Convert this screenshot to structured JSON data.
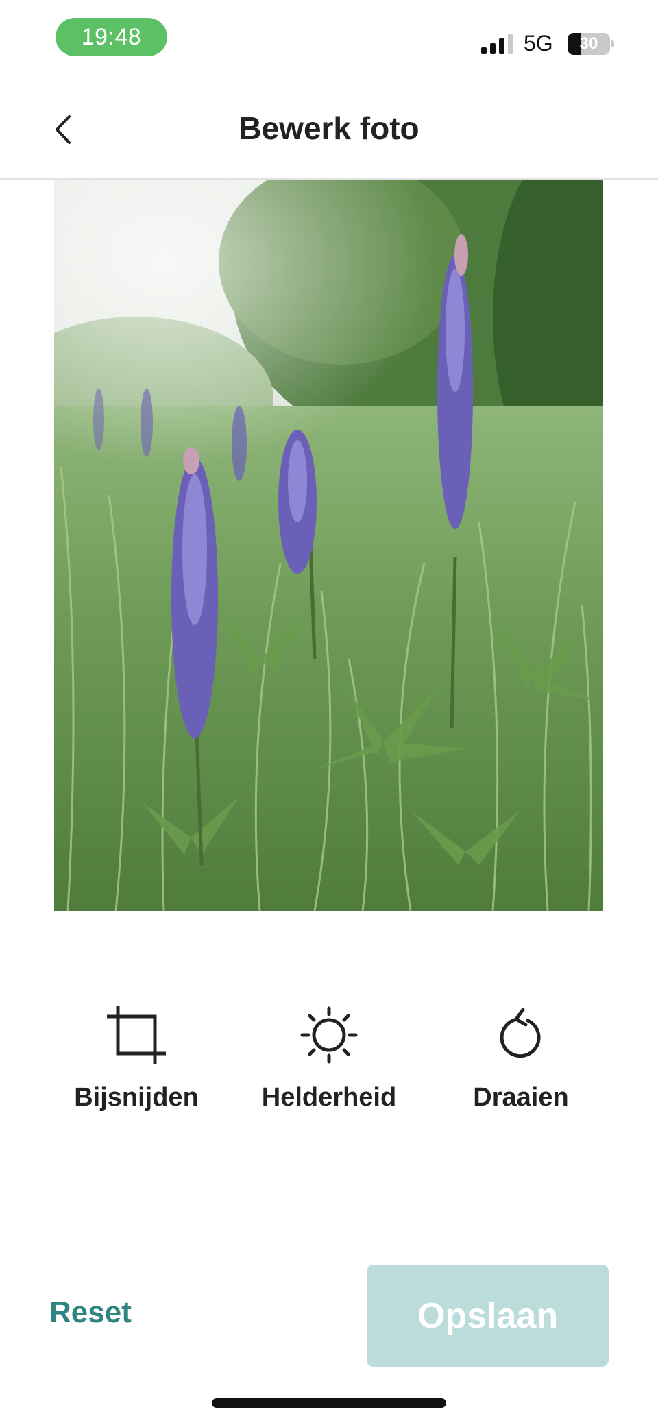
{
  "status_bar": {
    "time": "19:48",
    "network": "5G",
    "battery_level": "30",
    "battery_fraction": 0.3,
    "signal_bars_active": 3,
    "signal_bars_total": 4,
    "time_pill_color": "#5cc164"
  },
  "header": {
    "back_icon": "chevron-left-icon",
    "title": "Bewerk foto"
  },
  "photo": {
    "subject": "lupine-flowers-photo"
  },
  "tools": [
    {
      "label": "Bijsnijden",
      "icon": "crop-icon"
    },
    {
      "label": "Helderheid",
      "icon": "brightness-icon"
    },
    {
      "label": "Draaien",
      "icon": "rotate-icon"
    }
  ],
  "actions": {
    "reset_label": "Reset",
    "save_label": "Opslaan",
    "accent_color": "#2f8581",
    "save_disabled_color": "#bcdcdc"
  }
}
